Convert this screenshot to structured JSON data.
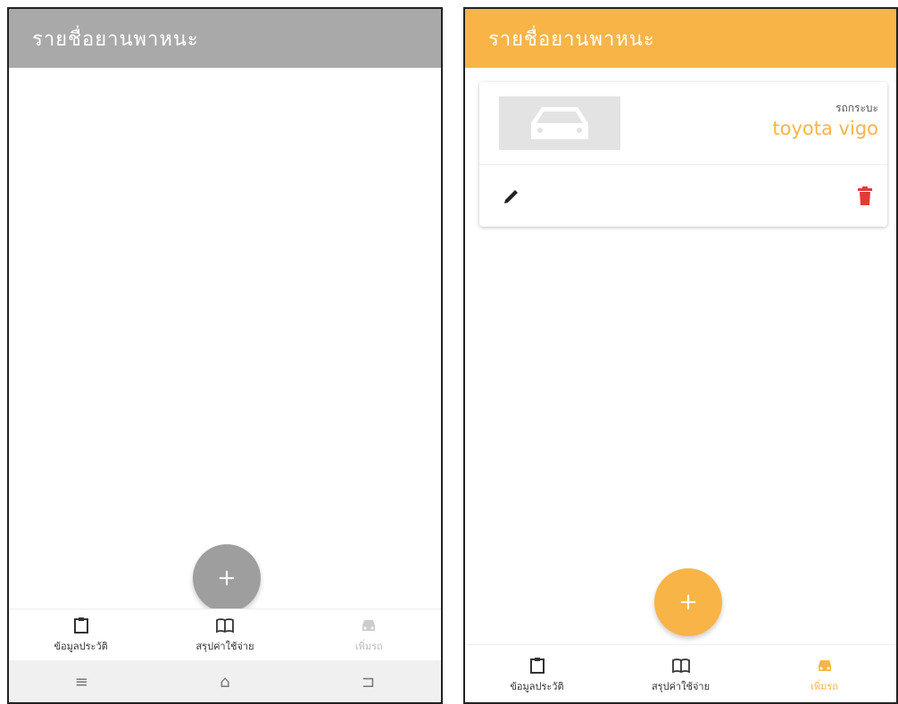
{
  "left": {
    "title": "รายชื่อยานพาหนะ",
    "fab_label": "+",
    "nav": [
      {
        "label": "ข้อมูลประวัติ"
      },
      {
        "label": "สรุปค่าใช้จ่าย"
      },
      {
        "label": "เพิ่มรถ"
      }
    ],
    "sys_nav": {
      "menu": "≡",
      "home": "⌂",
      "back": "⊐"
    }
  },
  "right": {
    "title": "รายชื่อยานพาหนะ",
    "card": {
      "type": "รถกระบะ",
      "name": "toyota vigo"
    },
    "fab_label": "+",
    "nav": [
      {
        "label": "ข้อมูลประวัติ"
      },
      {
        "label": "สรุปค่าใช้จ่าย"
      },
      {
        "label": "เพิ่มรถ"
      }
    ]
  },
  "colors": {
    "accent": "#f8b447",
    "delete": "#e53935",
    "disabled": "#a9a9a9"
  }
}
